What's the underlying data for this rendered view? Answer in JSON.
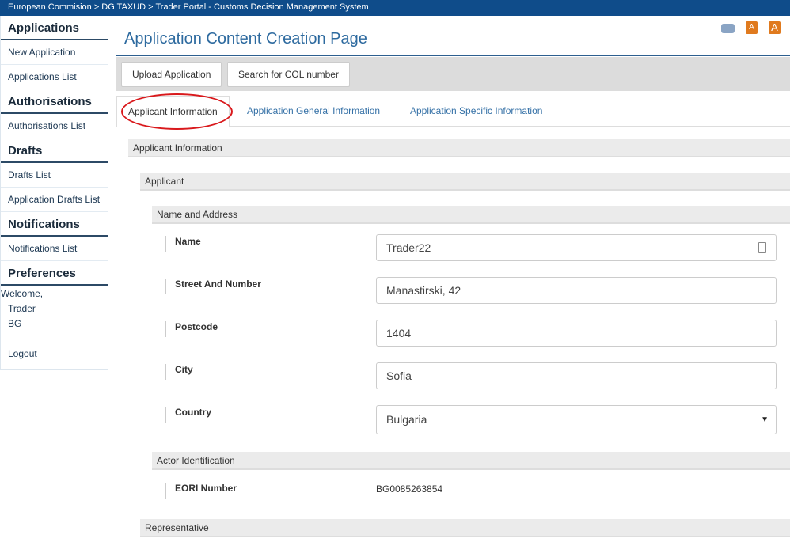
{
  "topbar": {
    "breadcrumb": "European Commision > DG TAXUD > Trader Portal - Customs Decision Management System"
  },
  "sidebar": {
    "applications": {
      "heading": "Applications",
      "items": [
        "New Application",
        "Applications List"
      ]
    },
    "authorisations": {
      "heading": "Authorisations",
      "items": [
        "Authorisations List"
      ]
    },
    "drafts": {
      "heading": "Drafts",
      "items": [
        "Drafts List",
        "Application Drafts List"
      ]
    },
    "notifications": {
      "heading": "Notifications",
      "items": [
        "Notifications List"
      ]
    },
    "preferences": {
      "heading": "Preferences"
    },
    "welcome": "Welcome,",
    "user": "Trader",
    "country": "BG",
    "logout": "Logout"
  },
  "page": {
    "title": "Application Content Creation Page",
    "icons": [
      "printer-icon",
      "font-decrease-icon",
      "font-increase-icon"
    ],
    "icon_letter": "A"
  },
  "toolbar": {
    "upload": "Upload Application",
    "search": "Search for COL number"
  },
  "tabs": [
    "Applicant Information",
    "Application General Information",
    "Application Specific Information"
  ],
  "sections": {
    "applicant_information": "Applicant Information",
    "applicant": "Applicant",
    "name_and_address": "Name and Address",
    "actor_identification": "Actor Identification",
    "representative": "Representative"
  },
  "fields": {
    "name": {
      "label": "Name",
      "value": "Trader22"
    },
    "street": {
      "label": "Street And Number",
      "value": "Manastirski, 42"
    },
    "postcode": {
      "label": "Postcode",
      "value": "1404"
    },
    "city": {
      "label": "City",
      "value": "Sofia"
    },
    "country": {
      "label": "Country",
      "value": "Bulgaria"
    },
    "eori": {
      "label": "EORI Number",
      "value": "BG0085263854"
    }
  },
  "colors": {
    "brand": "#0f4c8a",
    "highlight": "#d9191c"
  }
}
